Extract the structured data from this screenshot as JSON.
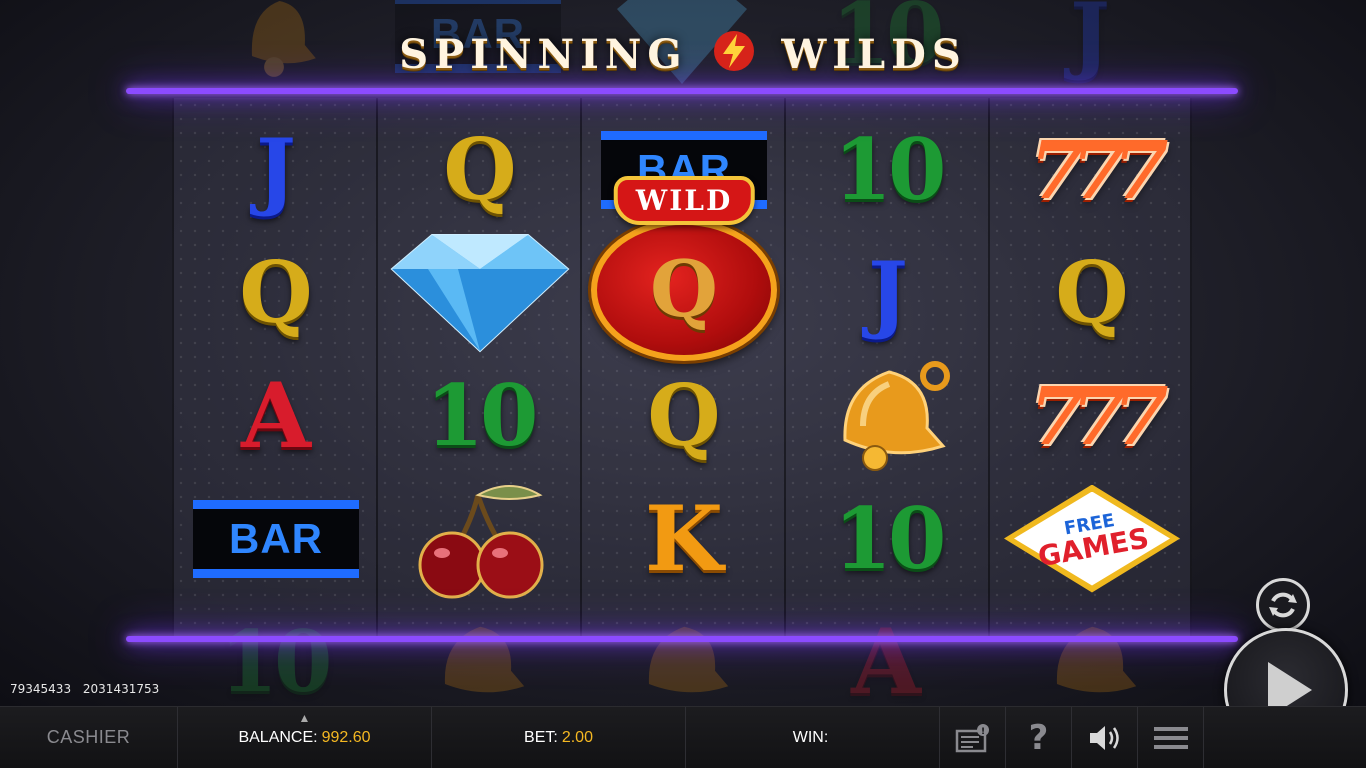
{
  "title": {
    "left": "SPINNING",
    "right": "WILDS",
    "logo_icon": "lightning-bolt-icon"
  },
  "reels": [
    [
      "J",
      "Q",
      "A",
      "BAR"
    ],
    [
      "Q",
      "diamond",
      "10",
      "cherry"
    ],
    [
      "BAR",
      "wild-Q",
      "Q",
      "K"
    ],
    [
      "10",
      "J",
      "bell",
      "10"
    ],
    [
      "777",
      "Q",
      "777",
      "free-games"
    ]
  ],
  "symbols": {
    "j": "J",
    "q": "Q",
    "a": "A",
    "k": "K",
    "ten": "10",
    "sevens": "777",
    "bar": "BAR",
    "wild": "WILD",
    "free": "FREE",
    "games": "GAMES"
  },
  "ghost_top": [
    "bell",
    "BAR",
    "diamond",
    "10",
    "J"
  ],
  "ghost_bottom": [
    "10",
    "bell",
    "bell",
    "A",
    "bell"
  ],
  "session": {
    "id1": "79345433",
    "id2": "2031431753"
  },
  "bottom_bar": {
    "cashier": "CASHIER",
    "balance_label": "BALANCE:",
    "balance_value": "992.60",
    "bet_label": "BET:",
    "bet_value": "2.00",
    "win_label": "WIN:",
    "win_value": ""
  },
  "icons": {
    "history": "history-icon",
    "help": "help-icon",
    "sound": "sound-icon",
    "menu": "menu-icon",
    "autoplay": "autoplay-icon",
    "spin": "spin-play-icon"
  },
  "help_glyph": "?",
  "colors": {
    "accent": "#f5b822",
    "neon": "#8c4bff"
  }
}
